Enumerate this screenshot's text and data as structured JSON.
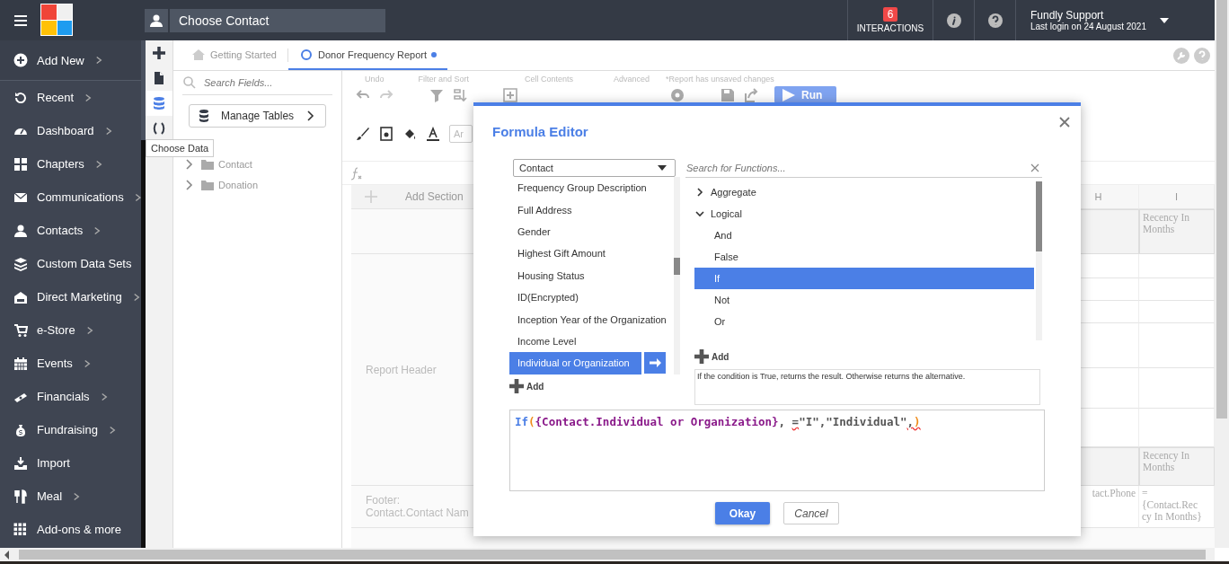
{
  "topbar": {
    "contact_placeholder": "Choose Contact",
    "interactions": {
      "count": "6",
      "label": "INTERACTIONS"
    },
    "user": {
      "name": "Fundly Support",
      "last_login": "Last login on 24 August 2021"
    }
  },
  "sidebar": {
    "items": [
      {
        "label": "Add New",
        "has_submenu": true
      },
      {
        "label": "Recent",
        "has_submenu": true
      },
      {
        "label": "Dashboard",
        "has_submenu": true
      },
      {
        "label": "Chapters",
        "has_submenu": true
      },
      {
        "label": "Communications",
        "has_submenu": true
      },
      {
        "label": "Contacts",
        "has_submenu": true
      },
      {
        "label": "Custom Data Sets",
        "has_submenu": false
      },
      {
        "label": "Direct Marketing",
        "has_submenu": true
      },
      {
        "label": "e-Store",
        "has_submenu": true
      },
      {
        "label": "Events",
        "has_submenu": true
      },
      {
        "label": "Financials",
        "has_submenu": true
      },
      {
        "label": "Fundraising",
        "has_submenu": true
      },
      {
        "label": "Import",
        "has_submenu": false
      },
      {
        "label": "Meal",
        "has_submenu": true
      },
      {
        "label": "Add-ons & more",
        "has_submenu": false
      }
    ]
  },
  "tool_strip": {
    "items": [
      {
        "selected": false
      },
      {
        "selected": false
      },
      {
        "selected": true
      },
      {
        "selected": false
      }
    ],
    "tooltip": "Choose Data"
  },
  "tabs": [
    {
      "label": "Getting Started",
      "selected": false,
      "unsaved": false
    },
    {
      "label": "Donor Frequency Report",
      "selected": true,
      "unsaved": true
    }
  ],
  "fields_panel": {
    "search_placeholder": "Search Fields...",
    "manage_button": "Manage Tables",
    "tables": [
      {
        "label": "Contact",
        "expanded": false
      },
      {
        "label": "Donation",
        "expanded": false
      }
    ]
  },
  "toolbar": {
    "groups": [
      "Undo",
      "Filter and Sort",
      "Cell Contents",
      "Advanced"
    ],
    "unsaved_note": "*Report has unsaved changes",
    "run_button": "Run",
    "font_field": "Ar"
  },
  "report": {
    "add_section": "Add Section",
    "columns": [
      "H",
      "I"
    ],
    "sections": [
      {
        "rows": [
          {
            "col_i": "Recency In Months"
          }
        ]
      },
      {
        "label": "Report Header",
        "rows": [
          {},
          {},
          {},
          {},
          {},
          {},
          {
            "col_i": "Recency In Months"
          }
        ]
      },
      {
        "label": "Footer:\nContact.Contact Nam",
        "rows": [
          {
            "col_h": "tact.Phone",
            "col_i": "=\n{Contact.Rec\ncy In Months}"
          }
        ]
      }
    ]
  },
  "dialog": {
    "title": "Formula Editor",
    "table_select": "Contact",
    "fields": [
      {
        "label": "Frequency Group Description",
        "selected": false
      },
      {
        "label": "Full Address",
        "selected": false
      },
      {
        "label": "Gender",
        "selected": false
      },
      {
        "label": "Highest Gift Amount",
        "selected": false
      },
      {
        "label": "Housing Status",
        "selected": false
      },
      {
        "label": "ID(Encrypted)",
        "selected": false
      },
      {
        "label": "Inception Year of the Organization",
        "selected": false
      },
      {
        "label": "Income Level",
        "selected": false
      },
      {
        "label": "Individual or Organization",
        "selected": true
      }
    ],
    "fields_add": "Add",
    "function_search_placeholder": "Search for Functions...",
    "functions": [
      {
        "label": "Aggregate",
        "expanded": false
      },
      {
        "label": "Logical",
        "expanded": true,
        "children": [
          {
            "label": "And",
            "selected": false
          },
          {
            "label": "False",
            "selected": false
          },
          {
            "label": "If",
            "selected": true
          },
          {
            "label": "Not",
            "selected": false
          },
          {
            "label": "Or",
            "selected": false
          }
        ]
      }
    ],
    "functions_add": "Add",
    "description": "If the condition is True, returns the result. Otherwise returns the alternative.",
    "formula": [
      {
        "kind": "function",
        "text": "If"
      },
      {
        "kind": "paren",
        "text": "("
      },
      {
        "kind": "field",
        "text": "{Contact.Individual or Organization}"
      },
      {
        "kind": "plain",
        "text": ", "
      },
      {
        "kind": "error",
        "text": "="
      },
      {
        "kind": "plain",
        "text": "\"I\",\"Individual\""
      },
      {
        "kind": "error",
        "text": ","
      },
      {
        "kind": "paren_error",
        "text": ")"
      }
    ],
    "ok_button": "Okay",
    "cancel_button": "Cancel"
  }
}
